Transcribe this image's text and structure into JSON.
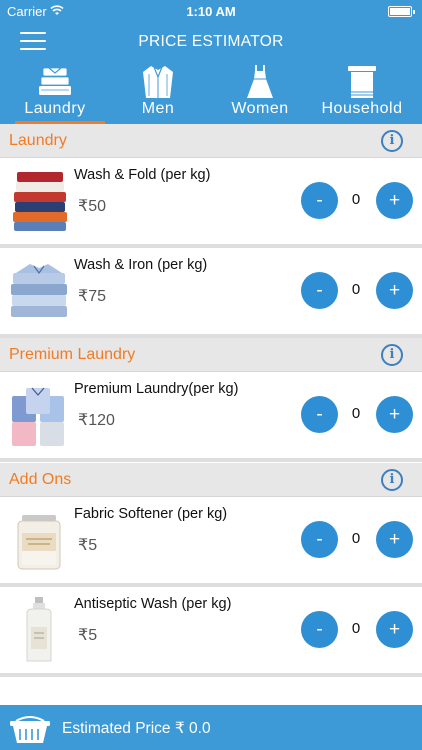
{
  "status_bar": {
    "carrier": "Carrier",
    "time": "1:10 AM"
  },
  "header": {
    "title": "PRICE ESTIMATOR"
  },
  "tabs": [
    {
      "label": "Laundry",
      "icon": "folded-clothes-icon",
      "active": true
    },
    {
      "label": "Men",
      "icon": "shirt-icon",
      "active": false
    },
    {
      "label": "Women",
      "icon": "dress-icon",
      "active": false
    },
    {
      "label": "Household",
      "icon": "towel-icon",
      "active": false
    }
  ],
  "sections": [
    {
      "title": "Laundry",
      "items": [
        {
          "name": "Wash & Fold (per kg)",
          "price": "50",
          "qty": "0"
        },
        {
          "name": "Wash & Iron (per kg)",
          "price": "75",
          "qty": "0"
        }
      ]
    },
    {
      "title": "Premium Laundry",
      "items": [
        {
          "name": "Premium Laundry(per kg)",
          "price": "120",
          "qty": "0"
        }
      ]
    },
    {
      "title": "Add Ons",
      "items": [
        {
          "name": "Fabric Softener (per kg)",
          "price": "5",
          "qty": "0"
        },
        {
          "name": "Antiseptic Wash (per kg)",
          "price": "5",
          "qty": "0"
        }
      ]
    }
  ],
  "controls": {
    "minus": "-",
    "plus": "+",
    "currency": "₹",
    "info": "i"
  },
  "footer": {
    "label": "Estimated Price ₹ 0.0"
  },
  "colors": {
    "primary": "#3d9ad6",
    "accent": "#f37b22",
    "button": "#2f8fd4"
  }
}
